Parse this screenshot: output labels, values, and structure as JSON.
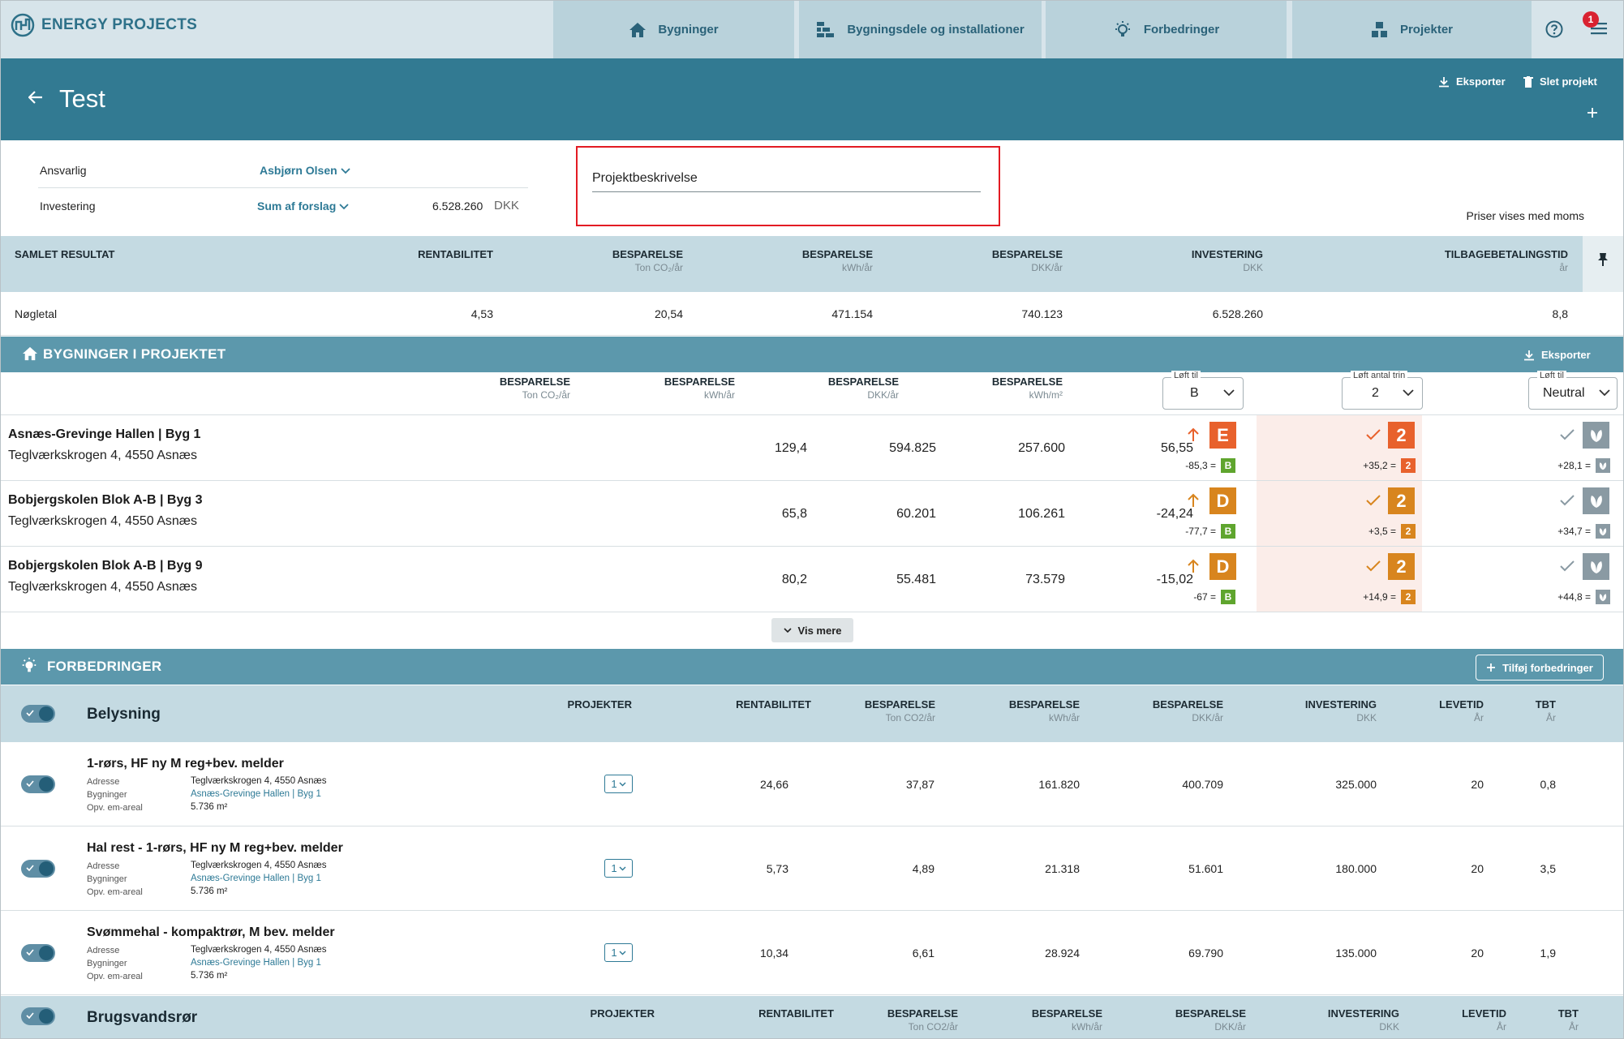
{
  "topbar": {
    "logo_text": "ENERGY PROJECTS",
    "tabs": [
      {
        "label": "Bygninger",
        "icon": "home-icon"
      },
      {
        "label": "Bygningsdele og installationer",
        "icon": "building-parts-icon"
      },
      {
        "label": "Forbedringer",
        "icon": "lightbulb-icon"
      },
      {
        "label": "Projekter",
        "icon": "projects-icon"
      }
    ],
    "notification_count": "1"
  },
  "header": {
    "title": "Test",
    "export_label": "Eksporter",
    "delete_label": "Slet projekt"
  },
  "info": {
    "responsible_label": "Ansvarlig",
    "responsible_value": "Asbjørn Olsen",
    "investment_label": "Investering",
    "investment_mode": "Sum af forslag",
    "investment_amount": "6.528.260",
    "investment_currency": "DKK",
    "description_placeholder": "Projektbeskrivelse",
    "vat_note": "Priser vises med moms"
  },
  "summary": {
    "title": "SAMLET RESULTAT",
    "columns": [
      {
        "label": "RENTABILITET",
        "unit": ""
      },
      {
        "label": "BESPARELSE",
        "unit": "Ton CO₂/år"
      },
      {
        "label": "BESPARELSE",
        "unit": "kWh/år"
      },
      {
        "label": "BESPARELSE",
        "unit": "DKK/år"
      },
      {
        "label": "INVESTERING",
        "unit": "DKK"
      },
      {
        "label": "TILBAGEBETALINGSTID",
        "unit": "år"
      }
    ],
    "row_label": "Nøgletal",
    "values": [
      "4,53",
      "20,54",
      "471.154",
      "740.123",
      "6.528.260",
      "8,8"
    ]
  },
  "buildings": {
    "title": "BYGNINGER I PROJEKTET",
    "export_label": "Eksporter",
    "columns": [
      {
        "label": "BESPARELSE",
        "unit": "Ton CO₂/år"
      },
      {
        "label": "BESPARELSE",
        "unit": "kWh/år"
      },
      {
        "label": "BESPARELSE",
        "unit": "DKK/år"
      },
      {
        "label": "BESPARELSE",
        "unit": "kWh/m²"
      }
    ],
    "lift_to": {
      "legend": "Løft til",
      "value": "B"
    },
    "lift_steps": {
      "legend": "Løft antal trin",
      "value": "2"
    },
    "lift_neutral": {
      "legend": "Løft til",
      "value": "Neutral"
    },
    "rows": [
      {
        "name": "Asnæs-Grevinge Hallen | Byg 1",
        "address": "Teglværkskrogen 4, 4550 Asnæs",
        "values": [
          "56,55",
          "257.600",
          "594.825",
          "129,4"
        ],
        "grade": "E",
        "grade_color": "#e8612c",
        "grade_delta": "-85,3 =",
        "target_grade": "B",
        "steps": "2",
        "steps_color": "#e8612c",
        "steps_delta": "+35,2 =",
        "steps_mini": "2",
        "neutral_delta": "+28,1 ="
      },
      {
        "name": "Bobjergskolen Blok A-B | Byg 3",
        "address": "Teglværkskrogen 4, 4550 Asnæs",
        "values": [
          "-24,24",
          "106.261",
          "60.201",
          "65,8"
        ],
        "grade": "D",
        "grade_color": "#d8851e",
        "grade_delta": "-77,7 =",
        "target_grade": "B",
        "steps": "2",
        "steps_color": "#d8851e",
        "steps_delta": "+3,5 =",
        "steps_mini": "2",
        "neutral_delta": "+34,7 ="
      },
      {
        "name": "Bobjergskolen Blok A-B | Byg 9",
        "address": "Teglværkskrogen 4, 4550 Asnæs",
        "values": [
          "-15,02",
          "73.579",
          "55.481",
          "80,2"
        ],
        "grade": "D",
        "grade_color": "#d8851e",
        "grade_delta": "-67 =",
        "target_grade": "B",
        "steps": "2",
        "steps_color": "#d8851e",
        "steps_delta": "+14,9 =",
        "steps_mini": "2",
        "neutral_delta": "+44,8 ="
      }
    ],
    "show_more_label": "Vis mere"
  },
  "improvements": {
    "title": "FORBEDRINGER",
    "add_label": "Tilføj forbedringer",
    "columns": [
      {
        "label": "PROJEKTER",
        "unit": ""
      },
      {
        "label": "RENTABILITET",
        "unit": ""
      },
      {
        "label": "BESPARELSE",
        "unit": "Ton CO2/år"
      },
      {
        "label": "BESPARELSE",
        "unit": "kWh/år"
      },
      {
        "label": "BESPARELSE",
        "unit": "DKK/år"
      },
      {
        "label": "INVESTERING",
        "unit": "DKK"
      },
      {
        "label": "LEVETID",
        "unit": "År"
      },
      {
        "label": "TBT",
        "unit": "År"
      }
    ],
    "categories": [
      {
        "name": "Belysning",
        "items": [
          {
            "name": "1-rørs, HF ny M reg+bev. melder",
            "address_label": "Adresse",
            "address": "Teglværkskrogen 4, 4550 Asnæs",
            "buildings_label": "Bygninger",
            "building": "Asnæs-Grevinge Hallen | Byg 1",
            "area_label": "Opv. em-areal",
            "area": "5.736 m²",
            "projects": "1",
            "values": [
              "24,66",
              "37,87",
              "161.820",
              "400.709",
              "325.000",
              "20",
              "0,8"
            ]
          },
          {
            "name": "Hal rest - 1-rørs, HF ny M reg+bev. melder",
            "address_label": "Adresse",
            "address": "Teglværkskrogen 4, 4550 Asnæs",
            "buildings_label": "Bygninger",
            "building": "Asnæs-Grevinge Hallen | Byg 1",
            "area_label": "Opv. em-areal",
            "area": "5.736 m²",
            "projects": "1",
            "values": [
              "5,73",
              "4,89",
              "21.318",
              "51.601",
              "180.000",
              "20",
              "3,5"
            ]
          },
          {
            "name": "Svømmehal - kompaktrør, M bev. melder",
            "address_label": "Adresse",
            "address": "Teglværkskrogen 4, 4550 Asnæs",
            "buildings_label": "Bygninger",
            "building": "Asnæs-Grevinge Hallen | Byg 1",
            "area_label": "Opv. em-areal",
            "area": "5.736 m²",
            "projects": "1",
            "values": [
              "10,34",
              "6,61",
              "28.924",
              "69.790",
              "135.000",
              "20",
              "1,9"
            ]
          }
        ]
      },
      {
        "name": "Brugsvandsrør",
        "items": []
      }
    ]
  },
  "colors": {
    "accent": "#327a92",
    "section": "#5c98ac",
    "table_head": "#c4dae2",
    "alert": "#e31b23",
    "grade_b": "#5fa52e"
  }
}
